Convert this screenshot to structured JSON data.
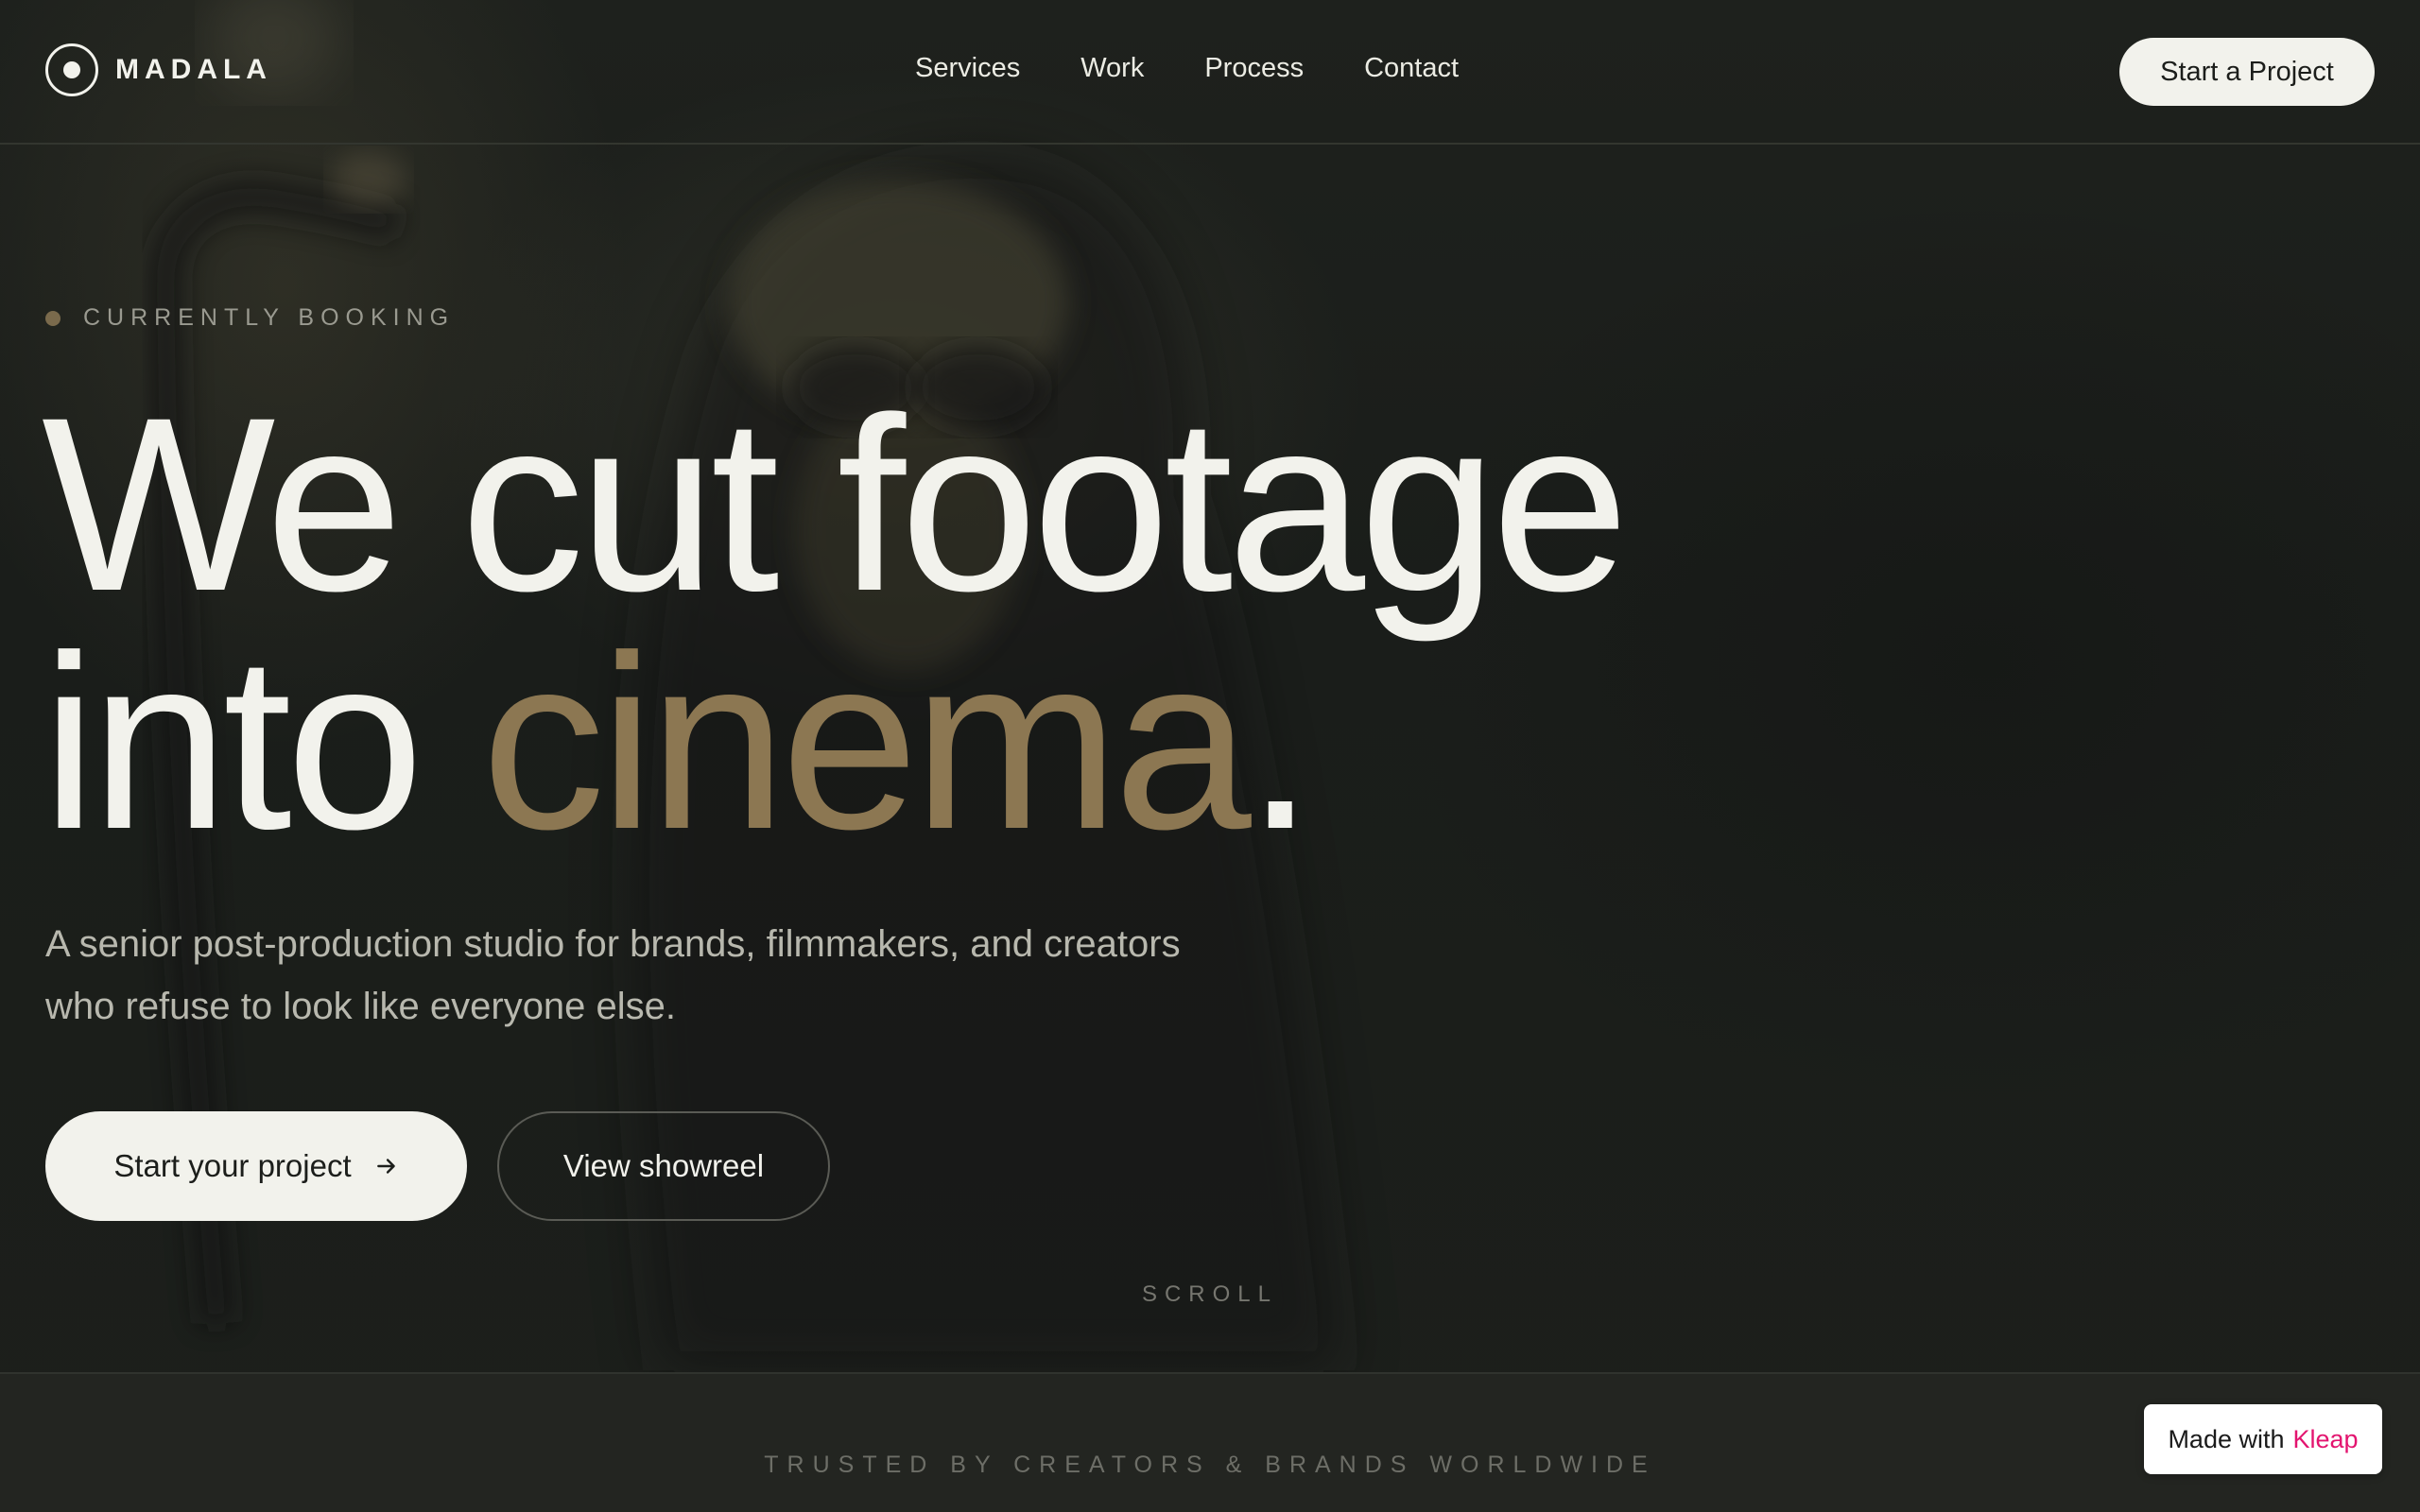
{
  "brand": {
    "name": "MADALA"
  },
  "nav": {
    "items": [
      {
        "label": "Services"
      },
      {
        "label": "Work"
      },
      {
        "label": "Process"
      },
      {
        "label": "Contact"
      }
    ],
    "cta_label": "Start a Project"
  },
  "hero": {
    "badge": "CURRENTLY BOOKING",
    "headline_line1": "We cut footage",
    "headline_line2_start": "into ",
    "headline_accent": "cinema",
    "headline_end": ".",
    "subtitle": "A senior post-production studio for brands, filmmakers, and creators who refuse to look like everyone else.",
    "primary_label": "Start your project",
    "secondary_label": "View showreel",
    "scroll_label": "SCROLL"
  },
  "trusted": {
    "label": "TRUSTED BY CREATORS & BRANDS WORLDWIDE"
  },
  "badge": {
    "prefix": "Made with",
    "brand": "Kleap",
    "brand_color": "#e3146f"
  },
  "colors": {
    "background": "#1e211e",
    "text": "#f2f2ec",
    "accent": "#8c7752"
  }
}
